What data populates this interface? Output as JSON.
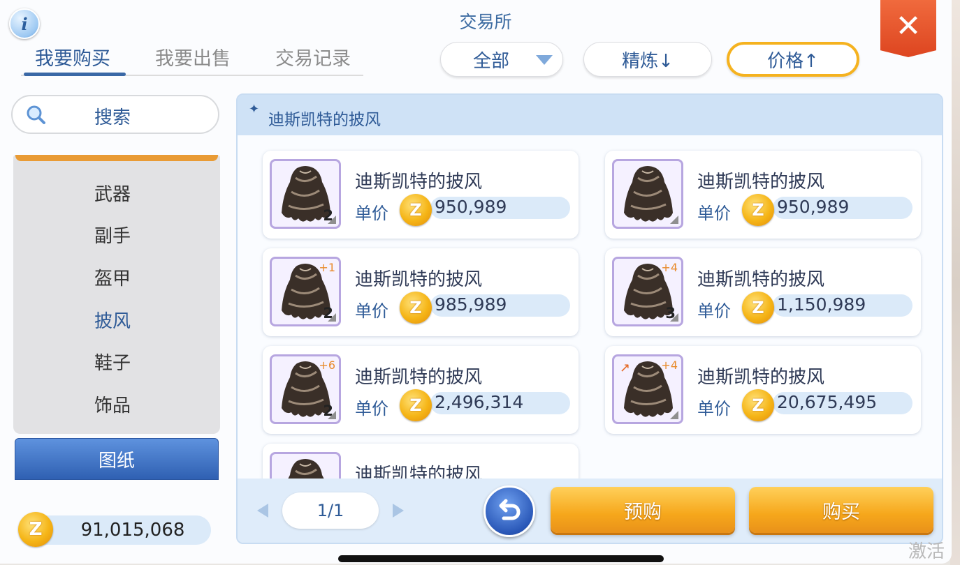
{
  "window": {
    "title": "交易所",
    "info_icon": "i",
    "close_icon": "✕"
  },
  "tabs": [
    {
      "label": "我要购买",
      "active": true
    },
    {
      "label": "我要出售",
      "active": false
    },
    {
      "label": "交易记录",
      "active": false
    }
  ],
  "filters": {
    "category_select": "全部",
    "refine_sort": "精炼↓",
    "price_sort": "价格↑"
  },
  "search": {
    "label": "搜索"
  },
  "categories": [
    "武器",
    "副手",
    "盔甲",
    "披风",
    "鞋子",
    "饰品"
  ],
  "active_category": "披风",
  "blueprint_button": "图纸",
  "wallet": {
    "amount": "91,015,068"
  },
  "list": {
    "header": "迪斯凯特的披风",
    "price_label": "单价",
    "items": [
      {
        "name": "迪斯凯特的披风",
        "price": "950,989",
        "qty": "2",
        "refine": ""
      },
      {
        "name": "迪斯凯特的披风",
        "price": "950,989",
        "qty": "",
        "refine": ""
      },
      {
        "name": "迪斯凯特的披风",
        "price": "985,989",
        "qty": "2",
        "refine": "+1"
      },
      {
        "name": "迪斯凯特的披风",
        "price": "1,150,989",
        "qty": "3",
        "refine": "+4"
      },
      {
        "name": "迪斯凯特的披风",
        "price": "2,496,314",
        "qty": "2",
        "refine": "+6"
      },
      {
        "name": "迪斯凯特的披风",
        "price": "20,675,495",
        "qty": "",
        "refine": "+4"
      },
      {
        "name": "迪斯凯特的披风",
        "price": "",
        "qty": "",
        "refine": ""
      }
    ]
  },
  "pagination": {
    "page": "1/1"
  },
  "actions": {
    "preorder": "预购",
    "buy": "购买"
  },
  "system": {
    "activate_watermark": "激活"
  },
  "colors": {
    "accent_blue": "#2f5b97",
    "highlight_orange": "#f5b21f",
    "close_red": "#dd4520"
  }
}
